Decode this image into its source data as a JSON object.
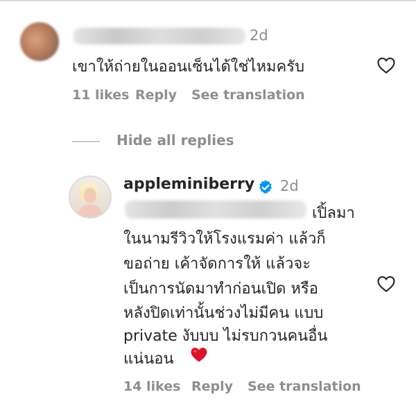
{
  "comment1": {
    "username": "",
    "time": "2d",
    "text": "เขาให้ถ่ายในออนเซ็นได้ใช่ไหมครับ",
    "likes": "11 likes",
    "reply": "Reply",
    "see_translation": "See translation"
  },
  "replies_toggle": {
    "label": "Hide all replies"
  },
  "reply1": {
    "username": "appleminiberry",
    "verified": true,
    "time": "2d",
    "mention": "",
    "lines": [
      "เปิ้ลมา",
      "ในนามรีวิวให้โรงแรมค่า แล้วก็",
      "ขอถ่าย เค้าจัดการให้ แล้วจะ",
      "เป็นการนัดมาทำก่อนเปิด หรือ",
      "หลังปิดเท่านั้นช่วงไม่มีคน แบบ",
      "private งับบบ ไม่รบกวนคนอื่น",
      "แน่นอน"
    ],
    "emoji": "red-heart",
    "likes": "14 likes",
    "reply": "Reply",
    "see_translation": "See translation"
  },
  "colors": {
    "text": "#262626",
    "secondary": "#8e8e8e",
    "verified_blue": "#0095f6",
    "heart_red": "#ed4956",
    "divider": "#dbdbdb"
  },
  "icons": [
    "heart-outline-icon",
    "verified-badge-icon",
    "red-heart-emoji"
  ]
}
